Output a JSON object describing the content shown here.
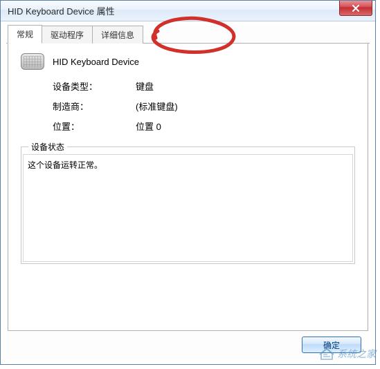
{
  "window": {
    "title": "HID Keyboard Device 属性"
  },
  "tabs": {
    "general": "常规",
    "driver": "驱动程序",
    "details": "详细信息"
  },
  "device": {
    "name": "HID Keyboard Device"
  },
  "info": {
    "device_type_label": "设备类型：",
    "device_type_value": "键盘",
    "manufacturer_label": "制造商：",
    "manufacturer_value": "(标准键盘)",
    "location_label": "位置：",
    "location_value": "位置 0"
  },
  "status": {
    "legend": "设备状态",
    "text": "这个设备运转正常。"
  },
  "buttons": {
    "ok": "确定"
  },
  "watermark": {
    "text": "系统之家"
  }
}
